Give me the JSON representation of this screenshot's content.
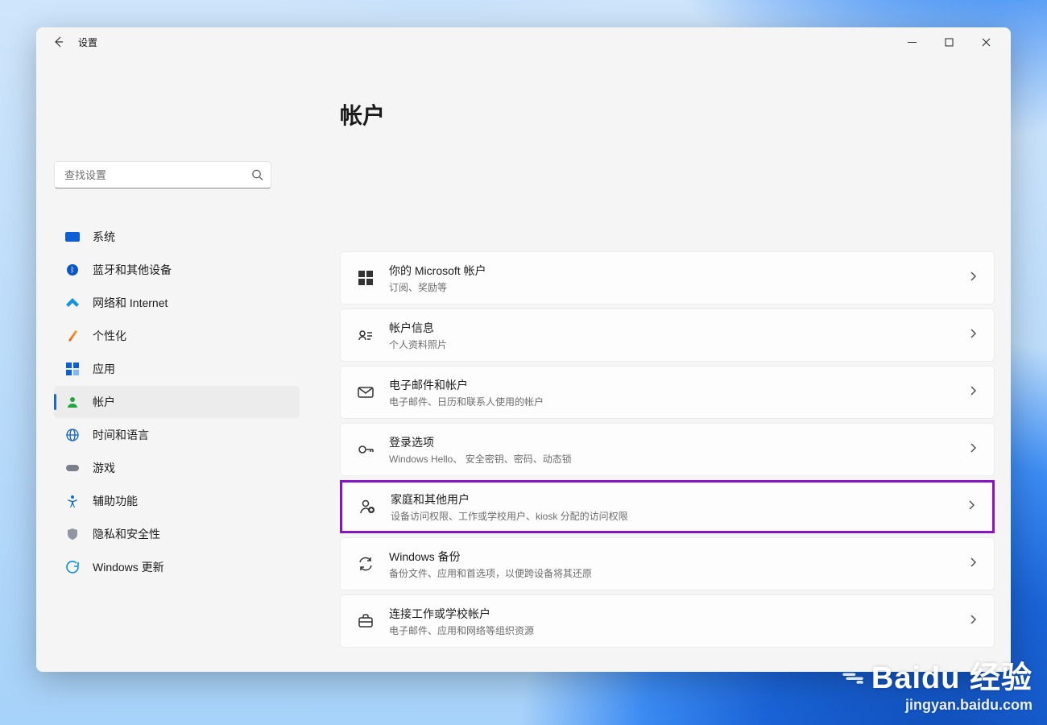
{
  "window": {
    "title": "设置"
  },
  "search": {
    "placeholder": "查找设置"
  },
  "page": {
    "title": "帐户"
  },
  "nav": [
    {
      "id": "system",
      "label": "系统"
    },
    {
      "id": "bt",
      "label": "蓝牙和其他设备"
    },
    {
      "id": "network",
      "label": "网络和 Internet"
    },
    {
      "id": "personal",
      "label": "个性化"
    },
    {
      "id": "apps",
      "label": "应用"
    },
    {
      "id": "accounts",
      "label": "帐户",
      "active": true
    },
    {
      "id": "time",
      "label": "时间和语言"
    },
    {
      "id": "gaming",
      "label": "游戏"
    },
    {
      "id": "access",
      "label": "辅助功能"
    },
    {
      "id": "privacy",
      "label": "隐私和安全性"
    },
    {
      "id": "update",
      "label": "Windows 更新"
    }
  ],
  "cards": [
    {
      "id": "ms-account",
      "title": "你的 Microsoft 帐户",
      "desc": "订阅、奖励等"
    },
    {
      "id": "account-info",
      "title": "帐户信息",
      "desc": "个人资料照片"
    },
    {
      "id": "email-accounts",
      "title": "电子邮件和帐户",
      "desc": "电子邮件、日历和联系人使用的帐户"
    },
    {
      "id": "signin-options",
      "title": "登录选项",
      "desc": "Windows Hello、 安全密钥、密码、动态锁"
    },
    {
      "id": "family-users",
      "title": "家庭和其他用户",
      "desc": "设备访问权限、工作或学校用户、kiosk 分配的访问权限",
      "highlight": true
    },
    {
      "id": "backup",
      "title": "Windows 备份",
      "desc": "备份文件、应用和首选项，以便跨设备将其还原"
    },
    {
      "id": "work-school",
      "title": "连接工作或学校帐户",
      "desc": "电子邮件、应用和网络等组织资源"
    }
  ],
  "watermark": {
    "brand": "Baidu 经验",
    "url": "jingyan.baidu.com"
  }
}
